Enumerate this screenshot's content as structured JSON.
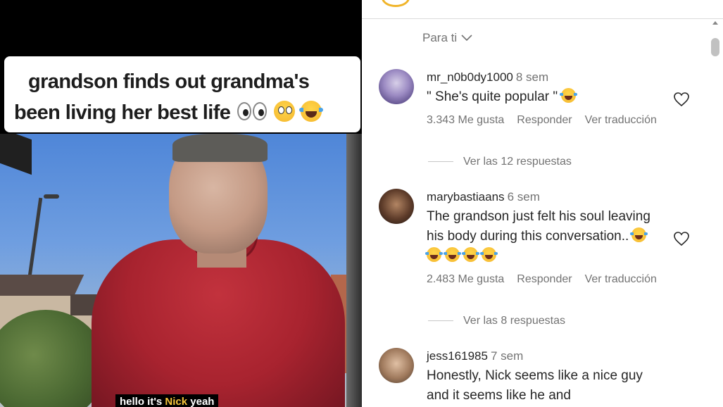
{
  "video": {
    "caption_line1": "grandson finds out grandma's",
    "caption_line2": "been living her best life",
    "caption_emojis": [
      "eyes-icon",
      "flushed-face-icon",
      "tears-of-joy-icon"
    ],
    "subtitle_pre": "hello it's ",
    "subtitle_highlight": "Nick",
    "subtitle_post": " yeah"
  },
  "comments_panel": {
    "sort_label": "Para ti",
    "comments": [
      {
        "username": "mr_n0b0dy1000",
        "time": "8 sem",
        "text": "\" She's quite popular \"",
        "emoji_count": 1,
        "likes": "3.343 Me gusta",
        "reply": "Responder",
        "translate": "Ver traducción",
        "view_replies": "Ver las 12 respuestas"
      },
      {
        "username": "marybastiaans",
        "time": "6 sem",
        "text": "The grandson just felt his soul leaving his body during this conversation..",
        "emoji_count": 5,
        "likes": "2.483 Me gusta",
        "reply": "Responder",
        "translate": "Ver traducción",
        "view_replies": "Ver las 8 respuestas"
      },
      {
        "username": "jess161985",
        "time": "7 sem",
        "text": "Honestly, Nick seems like a nice guy and it seems like he and"
      }
    ]
  },
  "colors": {
    "secondary_text": "#737373",
    "primary_text": "#262626",
    "caption_bg": "#ffffff"
  }
}
